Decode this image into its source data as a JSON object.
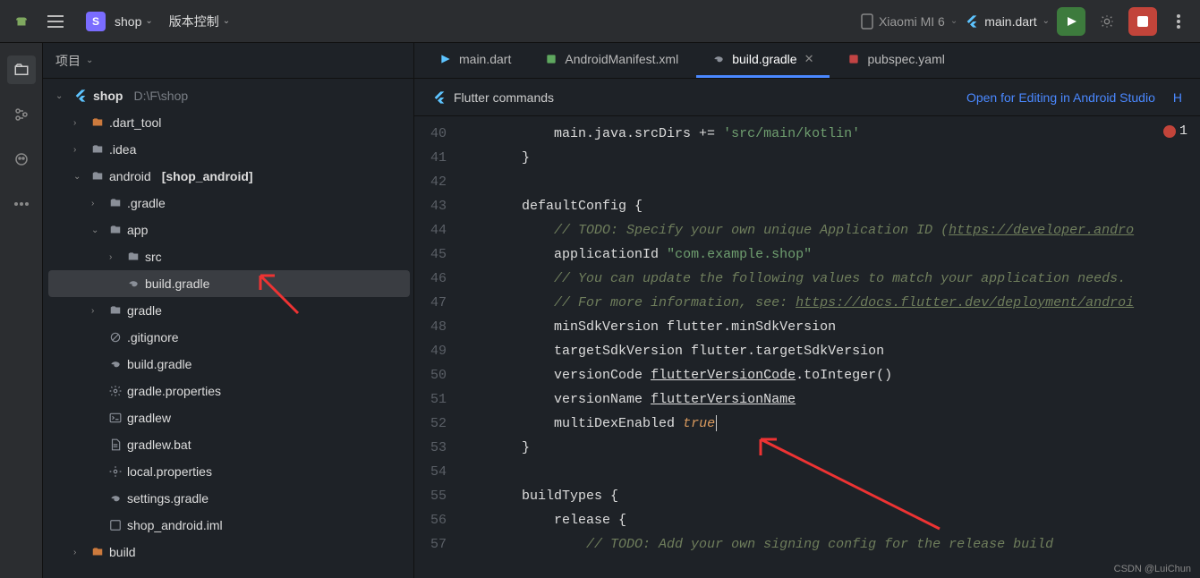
{
  "titlebar": {
    "project_badge": "S",
    "project_name": "shop",
    "vcs_label": "版本控制",
    "device": "Xiaomi MI 6",
    "run_config": "main.dart"
  },
  "sidebar_panel": {
    "title": "项目"
  },
  "tree": {
    "root": "shop",
    "root_path": "D:\\F\\shop",
    "items": [
      ".dart_tool",
      ".idea",
      "android",
      "[shop_android]",
      ".gradle",
      "app",
      "src",
      "build.gradle",
      "gradle",
      ".gitignore",
      "build.gradle",
      "gradle.properties",
      "gradlew",
      "gradlew.bat",
      "local.properties",
      "settings.gradle",
      "shop_android.iml",
      "build"
    ]
  },
  "tabs": {
    "t0": "main.dart",
    "t1": "AndroidManifest.xml",
    "t2": "build.gradle",
    "t3": "pubspec.yaml"
  },
  "cmdbar": {
    "title": "Flutter commands",
    "link1": "Open for Editing in Android Studio",
    "link2": "H"
  },
  "errors": {
    "count": "1"
  },
  "code": {
    "line_start": 40,
    "l40": "            main.java.srcDirs += 'src/main/kotlin'",
    "l41": "        }",
    "l42": "",
    "l43": "        defaultConfig {",
    "l44_cm": "            // TODO: Specify your own unique Application ID (",
    "l44_link": "https://developer.andro",
    "l45_pre": "            applicationId ",
    "l45_str": "\"com.example.shop\"",
    "l46": "            // You can update the following values to match your application needs.",
    "l47_a": "            // For more information, see: ",
    "l47_b": "https://docs.flutter.dev/deployment/androi",
    "l48": "            minSdkVersion flutter.minSdkVersion",
    "l49": "            targetSdkVersion flutter.targetSdkVersion",
    "l50_a": "            versionCode ",
    "l50_b": "flutterVersionCode",
    "l50_c": ".toInteger()",
    "l51_a": "            versionName ",
    "l51_b": "flutterVersionName",
    "l52_a": "            multiDexEnabled ",
    "l52_b": "true",
    "l53": "        }",
    "l54": "",
    "l55": "        buildTypes {",
    "l56": "            release {",
    "l57": "                // TODO: Add your own signing config for the release build"
  },
  "watermark": "CSDN @LuiChun",
  "chart_data": null
}
